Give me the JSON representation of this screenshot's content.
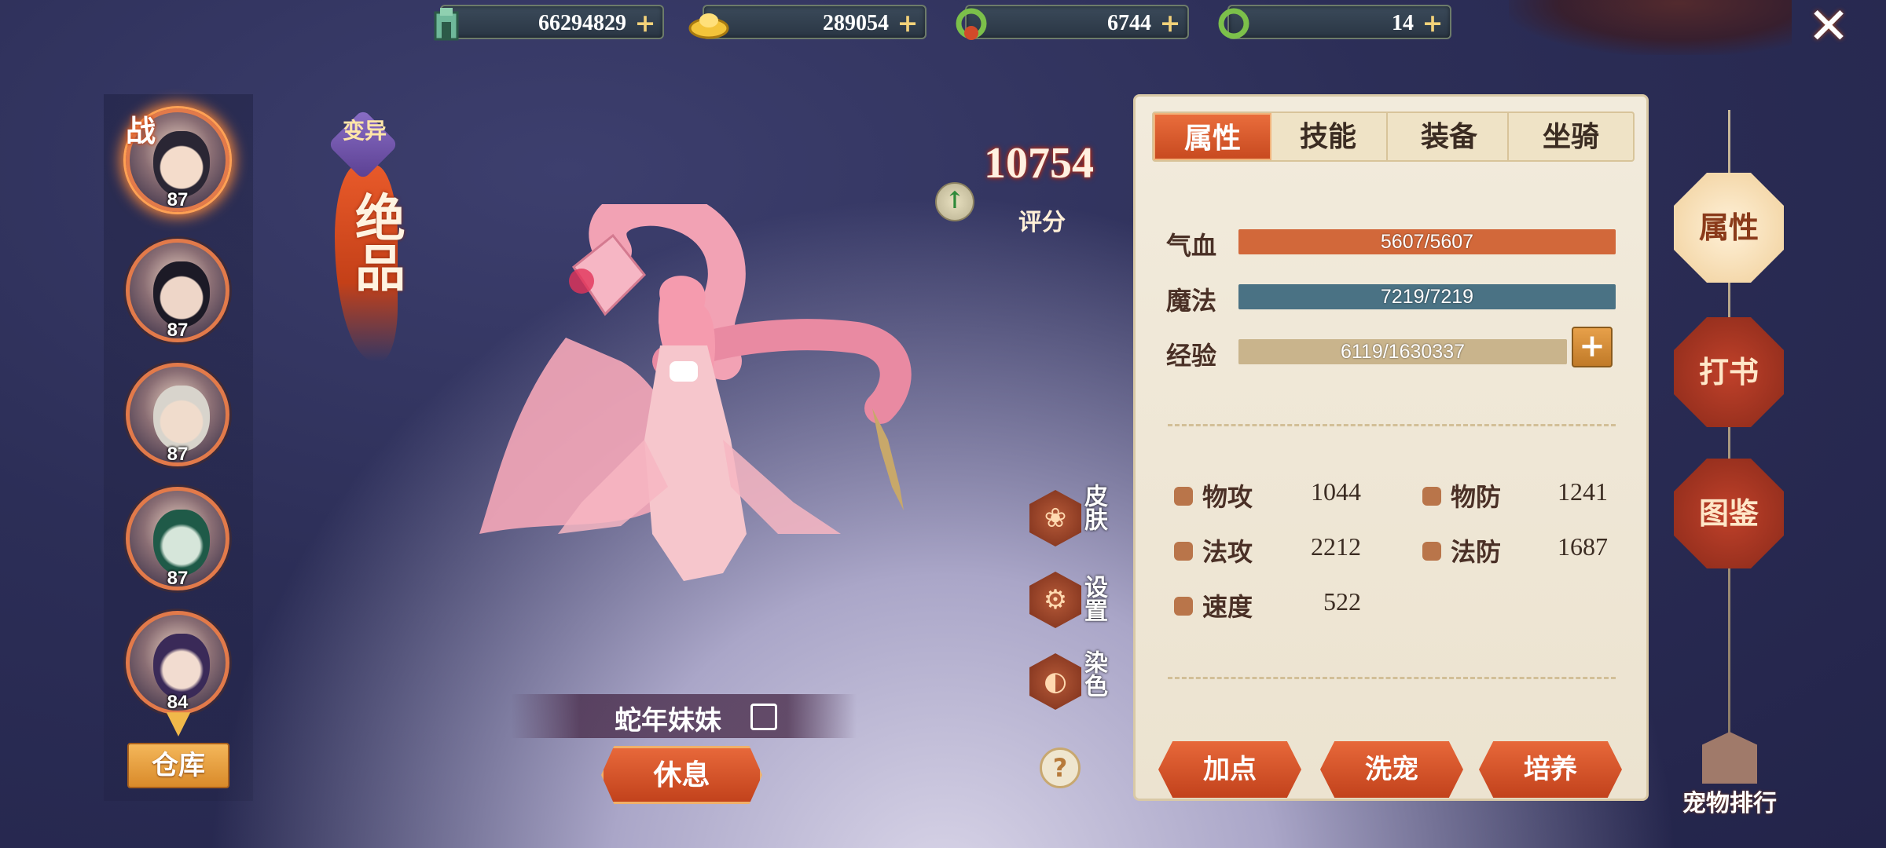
{
  "currencies": [
    {
      "icon": "jade-coin-icon",
      "value": "66294829"
    },
    {
      "icon": "gold-ingot-icon",
      "value": "289054"
    },
    {
      "icon": "green-dragon-bound-icon",
      "value": "6744"
    },
    {
      "icon": "green-dragon-icon",
      "value": "14"
    }
  ],
  "close_icon": "close-icon",
  "roster": {
    "battle_badge": "战",
    "pets": [
      {
        "level": "87",
        "active": true
      },
      {
        "level": "87"
      },
      {
        "level": "87"
      },
      {
        "level": "87"
      },
      {
        "level": "84"
      }
    ],
    "warehouse_label": "仓库"
  },
  "quality": {
    "mutation": "变异",
    "grade": "绝品"
  },
  "score": {
    "value": "10754",
    "label": "评分"
  },
  "pet": {
    "name": "蛇年妹妹",
    "rest_label": "休息"
  },
  "side_actions": [
    {
      "label": "皮肤",
      "icon": "skin-icon"
    },
    {
      "label": "设置",
      "icon": "gear-icon"
    },
    {
      "label": "染色",
      "icon": "palette-icon"
    }
  ],
  "help_label": "?",
  "tabs": [
    "属性",
    "技能",
    "装备",
    "坐骑"
  ],
  "active_tab": 0,
  "bars": [
    {
      "label": "气血",
      "text": "5607/5607",
      "fraction": 1.0,
      "color": "#d2683a"
    },
    {
      "label": "魔法",
      "text": "7219/7219",
      "fraction": 1.0,
      "color": "#4a7284"
    },
    {
      "label": "经验",
      "text": "6119/1630337",
      "fraction": 0.0038,
      "color": "#c9b48c"
    }
  ],
  "stats": [
    {
      "label": "物攻",
      "value": "1044"
    },
    {
      "label": "物防",
      "value": "1241"
    },
    {
      "label": "法攻",
      "value": "2212"
    },
    {
      "label": "法防",
      "value": "1687"
    },
    {
      "label": "速度",
      "value": "522"
    }
  ],
  "actions": [
    "加点",
    "洗宠",
    "培养"
  ],
  "nav": [
    "属性",
    "打书",
    "图鉴"
  ],
  "ranking_label": "宠物排行"
}
